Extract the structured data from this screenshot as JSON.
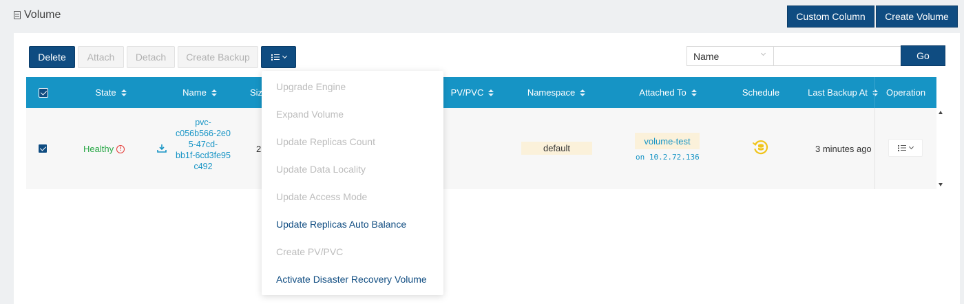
{
  "page": {
    "title": "Volume",
    "custom_column_label": "Custom Column",
    "create_volume_label": "Create Volume"
  },
  "toolbar": {
    "delete_label": "Delete",
    "attach_label": "Attach",
    "detach_label": "Detach",
    "create_backup_label": "Create Backup",
    "menu_icon": "list-icon"
  },
  "search": {
    "field_selected": "Name",
    "query_value": "",
    "go_label": "Go"
  },
  "table": {
    "columns": [
      {
        "label": "State",
        "sortable": true
      },
      {
        "label": "Name",
        "sortable": true
      },
      {
        "label": "Siz",
        "sortable": false
      },
      {
        "label": "PV/PVC",
        "sortable": true
      },
      {
        "label": "Namespace",
        "sortable": true
      },
      {
        "label": "Attached To",
        "sortable": true
      },
      {
        "label": "Schedule",
        "sortable": false
      },
      {
        "label": "Last Backup At",
        "sortable": true
      },
      {
        "label": "Operation",
        "sortable": false
      }
    ],
    "rows": [
      {
        "selected": true,
        "state": "Healthy",
        "state_info_icon": "!",
        "name_lines": [
          "pvc-",
          "c056b566-2e0",
          "5-47cd-",
          "bb1f-6cd3fe95",
          "c492"
        ],
        "size": "2",
        "namespace": "default",
        "attached_to": "volume-test",
        "attached_node": "on 10.2.72.136",
        "schedule_icon": "recurring-backup-icon",
        "last_backup": "3 minutes ago"
      }
    ]
  },
  "dropdown": {
    "items": [
      {
        "label": "Upgrade Engine",
        "enabled": false
      },
      {
        "label": "Expand Volume",
        "enabled": false
      },
      {
        "label": "Update Replicas Count",
        "enabled": false
      },
      {
        "label": "Update Data Locality",
        "enabled": false
      },
      {
        "label": "Update Access Mode",
        "enabled": false
      },
      {
        "label": "Update Replicas Auto Balance",
        "enabled": true
      },
      {
        "label": "Create PV/PVC",
        "enabled": false
      },
      {
        "label": "Activate Disaster Recovery Volume",
        "enabled": true
      }
    ]
  },
  "colors": {
    "primary": "#0f4c81",
    "header": "#1694c5",
    "healthy": "#27a745",
    "badge": "#fbf1da",
    "schedule": "#f0c419"
  }
}
